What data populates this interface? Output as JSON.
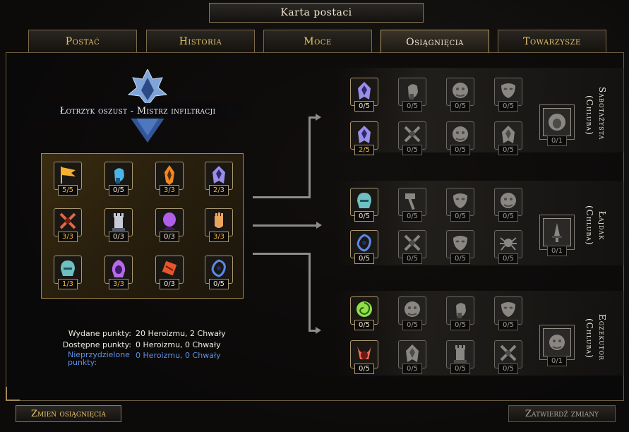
{
  "window": {
    "title": "Karta postaci"
  },
  "tabs": [
    {
      "label": "Postać",
      "active": false
    },
    {
      "label": "Historia",
      "active": false
    },
    {
      "label": "Moce",
      "active": false
    },
    {
      "label": "Osiągnięcia",
      "active": true
    },
    {
      "label": "Towarzysze",
      "active": false
    }
  ],
  "class_title": "Łotrzyk oszust - Mistrz infiltracji",
  "base_grid": [
    {
      "icon": "banner-icon",
      "count": "5/5",
      "gold": true
    },
    {
      "icon": "fist-icon",
      "count": "0/5",
      "gold": false
    },
    {
      "icon": "flame-mask-icon",
      "count": "3/3",
      "gold": true
    },
    {
      "icon": "cloaked-figure-icon",
      "count": "2/3",
      "gold": true
    },
    {
      "icon": "crossed-weapons-icon",
      "count": "3/3",
      "gold": true
    },
    {
      "icon": "rook-icon",
      "count": "0/3",
      "gold": false
    },
    {
      "icon": "shadow-head-icon",
      "count": "0/3",
      "gold": false
    },
    {
      "icon": "gauntlet-icon",
      "count": "3/3",
      "gold": true
    },
    {
      "icon": "helmet-icon",
      "count": "1/3",
      "gold": true
    },
    {
      "icon": "hooded-head-icon",
      "count": "3/3",
      "gold": true
    },
    {
      "icon": "scroll-icon",
      "count": "0/3",
      "gold": false
    },
    {
      "icon": "swirl-icon",
      "count": "0/5",
      "gold": false
    }
  ],
  "trees": [
    {
      "name": "Sabotażysta",
      "subtitle": "(Chluba)",
      "rows": [
        [
          {
            "icon": "cloaked-figure-icon",
            "count": "0/5",
            "color": true,
            "gold": false
          },
          {
            "icon": "fist-icon",
            "count": "0/5"
          },
          {
            "icon": "demon-face-icon",
            "count": "0/5"
          },
          {
            "icon": "mask-icon",
            "count": "0/5"
          }
        ],
        [
          {
            "icon": "cloaked-figure-icon",
            "count": "2/5",
            "color": true,
            "gold": true
          },
          {
            "icon": "crossed-weapons-icon",
            "count": "0/5"
          },
          {
            "icon": "demon-face-icon",
            "count": "0/5"
          },
          {
            "icon": "cloaked-figure-icon",
            "count": "0/5"
          }
        ]
      ],
      "capstone": {
        "icon": "lion-head-icon",
        "count": "0/1"
      }
    },
    {
      "name": "Łajdak",
      "subtitle": "(Chluba)",
      "rows": [
        [
          {
            "icon": "helmet-icon",
            "count": "0/5",
            "color": true,
            "gold": false
          },
          {
            "icon": "hammer-icon",
            "count": "0/5"
          },
          {
            "icon": "mask-icon",
            "count": "0/5"
          },
          {
            "icon": "demon-face-icon",
            "count": "0/5"
          }
        ],
        [
          {
            "icon": "swirl-icon",
            "count": "0/5",
            "color": true,
            "gold": false
          },
          {
            "icon": "crossed-weapons-icon",
            "count": "0/5"
          },
          {
            "icon": "mask-icon",
            "count": "0/5"
          },
          {
            "icon": "spider-icon",
            "count": "0/5"
          }
        ]
      ],
      "capstone": {
        "icon": "dagger-icon",
        "count": "0/1"
      }
    },
    {
      "name": "Egzekutor",
      "subtitle": "(Chluba)",
      "rows": [
        [
          {
            "icon": "vortex-icon",
            "count": "0/5",
            "color": true,
            "gold": false
          },
          {
            "icon": "demon-face-icon",
            "count": "0/5"
          },
          {
            "icon": "fist-icon",
            "count": "0/5"
          },
          {
            "icon": "mask-icon",
            "count": "0/5"
          }
        ],
        [
          {
            "icon": "flame-horns-icon",
            "count": "0/5",
            "color": true,
            "gold": false
          },
          {
            "icon": "cloaked-figure-icon",
            "count": "0/5"
          },
          {
            "icon": "rook-icon",
            "count": "0/5"
          },
          {
            "icon": "crossed-weapons-icon",
            "count": "0/5"
          }
        ]
      ],
      "capstone": {
        "icon": "demon-face-icon",
        "count": "0/1"
      }
    }
  ],
  "stats": {
    "spent_label": "Wydane punkty:",
    "spent_value": "20 Heroizmu, 2 Chwały",
    "available_label": "Dostępne punkty:",
    "available_value": "0 Heroizmu, 0 Chwały",
    "unassigned_label": "Nieprzydzielone punkty:",
    "unassigned_value": "0 Heroizmu, 0 Chwały"
  },
  "buttons": {
    "change": "Zmień osiągnięcia",
    "confirm": "Zatwierdź zmiany"
  },
  "colors": {
    "gold": "#f1b63d",
    "accent": "#e6c46a",
    "blue_text": "#5e8ee0"
  }
}
